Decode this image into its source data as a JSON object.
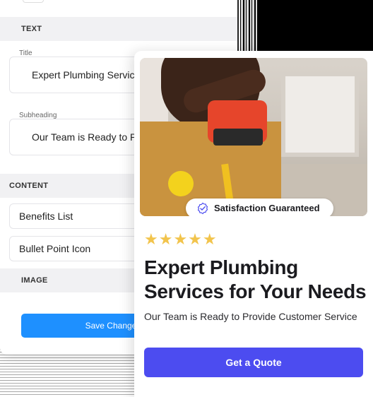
{
  "editor": {
    "sections": {
      "text": "TEXT",
      "content": "CONTENT",
      "image": "IMAGE"
    },
    "fields": {
      "title_label": "Title",
      "title_value": "Expert Plumbing Services for Your Needs",
      "subheading_label": "Subheading",
      "subheading_value": "Our Team is Ready to Provide Customer Service"
    },
    "content_items": [
      "Benefits List",
      "Bullet Point Icon"
    ],
    "save_label": "Save Changes"
  },
  "preview": {
    "badge_text": "Satisfaction Guaranteed",
    "stars": "★★★★★",
    "rating": 5,
    "headline": "Expert Plumbing Services for Your Needs",
    "subtext": "Our Team is Ready to Provide Customer Service",
    "cta_label": "Get a Quote"
  },
  "colors": {
    "primary": "#4c4cf0",
    "save": "#1e90ff",
    "star": "#f2c44c"
  }
}
